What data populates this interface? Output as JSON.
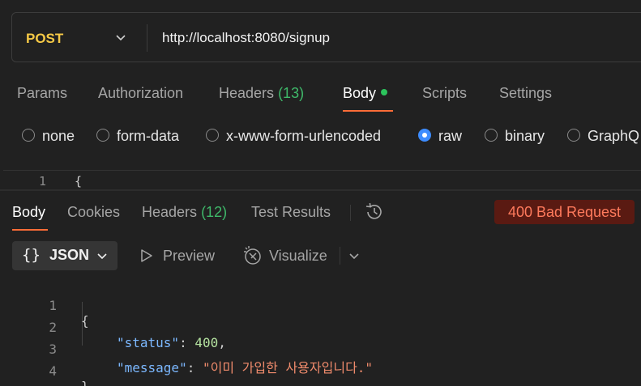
{
  "request": {
    "method": "POST",
    "url": "http://localhost:8080/signup",
    "tabs": [
      {
        "label": "Params"
      },
      {
        "label": "Authorization"
      },
      {
        "label": "Headers",
        "count": "(13)"
      },
      {
        "label": "Body"
      },
      {
        "label": "Scripts"
      },
      {
        "label": "Settings"
      }
    ],
    "active_tab": "Body",
    "body_modes": [
      "none",
      "form-data",
      "x-www-form-urlencoded",
      "raw",
      "binary",
      "GraphQ"
    ],
    "selected_body_mode": "raw",
    "editor_first_line": {
      "number": "1",
      "text": "{"
    }
  },
  "response": {
    "tabs": [
      {
        "label": "Body"
      },
      {
        "label": "Cookies"
      },
      {
        "label": "Headers",
        "count": "(12)"
      },
      {
        "label": "Test Results"
      }
    ],
    "active_tab": "Body",
    "status": "400 Bad Request",
    "format": "JSON",
    "preview_label": "Preview",
    "visualize_label": "Visualize",
    "lines": [
      {
        "number": "1",
        "open": "{"
      },
      {
        "number": "2",
        "key": "\"status\"",
        "colon": ": ",
        "value": "400",
        "trail": ","
      },
      {
        "number": "3",
        "key": "\"message\"",
        "colon": ": ",
        "value": "\"이미 가입한 사용자입니다.\"",
        "trail": ""
      },
      {
        "number": "4",
        "open": "}"
      }
    ]
  },
  "colors": {
    "accent": "#ff6c37",
    "method": "#f5c946",
    "error_badge_bg": "#5a1a12",
    "error_badge_text": "#ff7a5c",
    "count_green": "#3fb96a",
    "radio_selected": "#3d8cff"
  }
}
